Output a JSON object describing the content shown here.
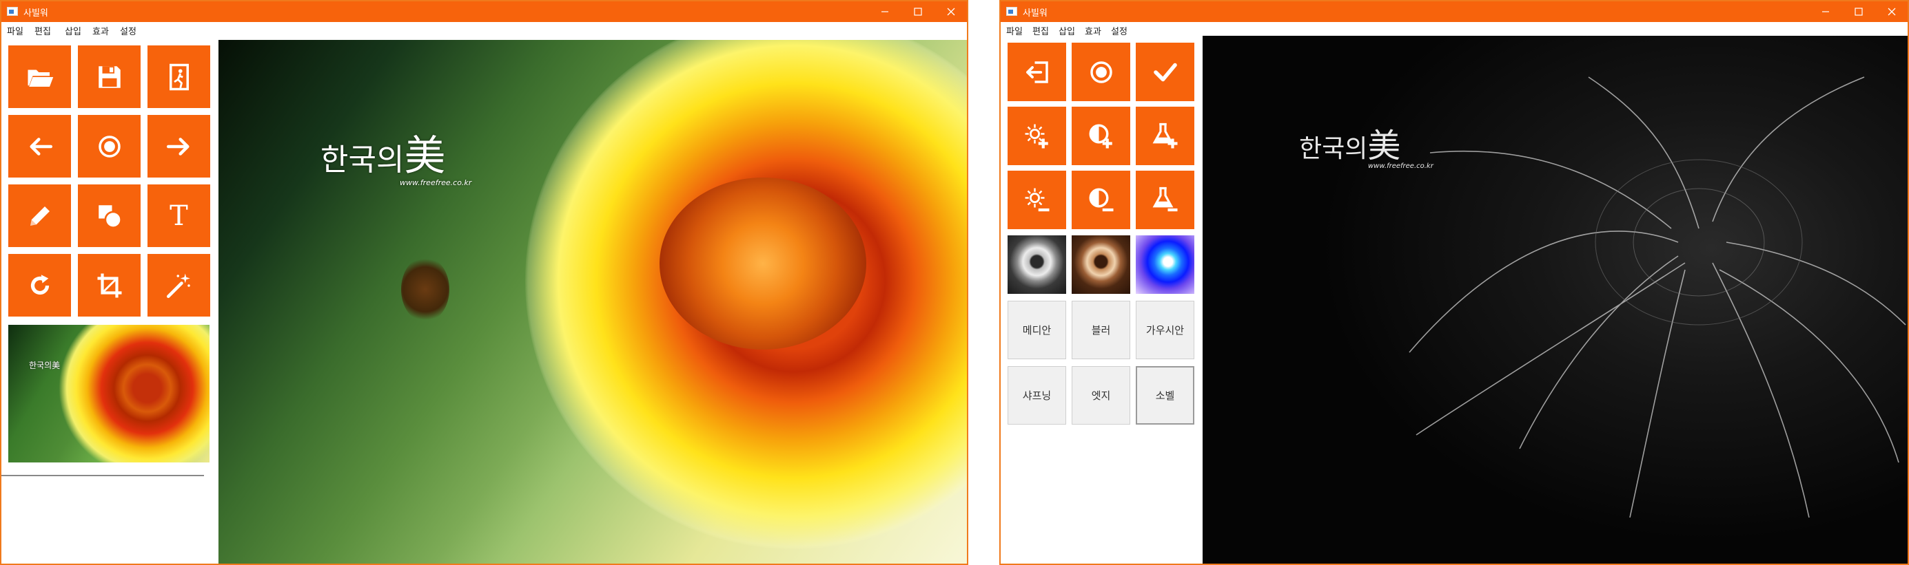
{
  "left_window": {
    "title": "사빌워",
    "menu": [
      "파일",
      "편집",
      "삽입",
      "효과",
      "설정"
    ],
    "tools": [
      {
        "name": "open-folder-icon"
      },
      {
        "name": "save-icon"
      },
      {
        "name": "exit-icon"
      },
      {
        "name": "undo-arrow-icon"
      },
      {
        "name": "record-icon"
      },
      {
        "name": "redo-arrow-icon"
      },
      {
        "name": "pencil-icon"
      },
      {
        "name": "shapes-icon"
      },
      {
        "name": "text-icon",
        "glyph": "T"
      },
      {
        "name": "rotate-icon"
      },
      {
        "name": "crop-icon"
      },
      {
        "name": "magic-wand-icon"
      }
    ],
    "watermark": {
      "hangul": "한국의",
      "hanja": "美",
      "url": "www.freefree.co.kr"
    }
  },
  "right_window": {
    "title": "사빌워",
    "menu": [
      "파일",
      "편집",
      "삽입",
      "효과",
      "설정"
    ],
    "tools": [
      {
        "name": "back-icon"
      },
      {
        "name": "record-icon"
      },
      {
        "name": "check-icon"
      },
      {
        "name": "brightness-up-icon"
      },
      {
        "name": "contrast-up-icon"
      },
      {
        "name": "saturation-up-icon"
      },
      {
        "name": "brightness-down-icon"
      },
      {
        "name": "contrast-down-icon"
      },
      {
        "name": "saturation-down-icon"
      }
    ],
    "filters": {
      "row1": [
        "메디안",
        "블러",
        "가우시안"
      ],
      "row2": [
        "샤프닝",
        "엣지",
        "소벨"
      ]
    },
    "watermark": {
      "hangul": "한국의",
      "hanja": "美",
      "url": "www.freefree.co.kr"
    }
  },
  "colors": {
    "accent": "#f7630c",
    "title_text": "#ffffff"
  }
}
